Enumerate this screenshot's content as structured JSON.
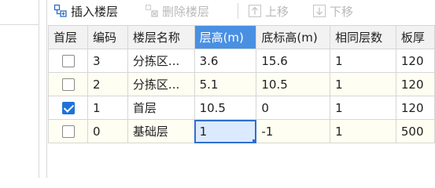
{
  "toolbar": {
    "insert": {
      "label": "插入楼层",
      "icon": "insert-floor-icon",
      "enabled": true
    },
    "delete": {
      "label": "删除楼层",
      "icon": "delete-floor-icon",
      "enabled": false
    },
    "move_up": {
      "label": "上移",
      "icon": "arrow-up-icon",
      "enabled": false
    },
    "move_down": {
      "label": "下移",
      "icon": "arrow-down-icon",
      "enabled": false
    }
  },
  "table": {
    "columns": [
      "首层",
      "编码",
      "楼层名称",
      "层高(m)",
      "底标高(m)",
      "相同层数",
      "板厚"
    ],
    "active_column_index": 3,
    "rows": [
      {
        "is_first": false,
        "code": "3",
        "name": "分拣区...",
        "height": "3.6",
        "base": "15.6",
        "same": "1",
        "slab": "120"
      },
      {
        "is_first": false,
        "code": "2",
        "name": "分拣区...",
        "height": "5.1",
        "base": "10.5",
        "same": "1",
        "slab": "120"
      },
      {
        "is_first": true,
        "code": "1",
        "name": "首层",
        "height": "10.5",
        "base": "0",
        "same": "1",
        "slab": "120"
      },
      {
        "is_first": false,
        "code": "0",
        "name": "基础层",
        "height": "1",
        "base": "-1",
        "same": "1",
        "slab": "500"
      }
    ],
    "editing_cell": {
      "row": 3,
      "column": "height"
    }
  },
  "colors": {
    "accent": "#4a90e2",
    "check": "#1e73d8",
    "row_tint": "#fffef2"
  }
}
